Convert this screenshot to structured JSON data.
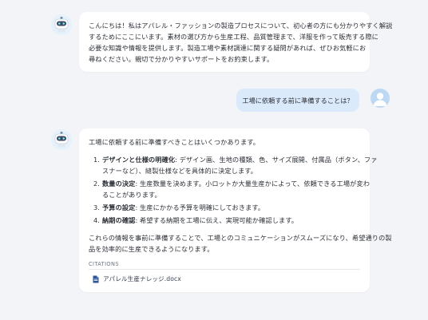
{
  "messages": {
    "bot1": {
      "lines": [
        "こんにちは！私はアパレル・ファッションの製造プロセスについて、初心者の方にも分かりやすく解説",
        "するためにここにいます。素材の選び方から生産工程、品質管理まで、洋服を作って販売する際に",
        "必要な知識や情報を提供します。製造工場や素材調達に関する疑問があれば、ぜひお気軽にお",
        "尋ねください。親切で分かりやすいサポートをお約束します。"
      ]
    },
    "user1": {
      "text": "工場に依頼する前に準備することは？"
    },
    "bot2": {
      "intro": "工場に依頼する前に準備すべきことはいくつかあります。",
      "items": [
        {
          "num": "1.",
          "title": "デザインと仕様の明確化",
          "lines": [
            ": デザイン画、生地の種類、色、サイズ展開、付属品（ボタン、ファ",
            "スナーなど）、縫製仕様などを具体的に決定します。"
          ]
        },
        {
          "num": "2.",
          "title": "数量の決定",
          "lines": [
            ": 生産数量を決めます。小ロットか大量生産かによって、依頼できる工場が変わ",
            "ることがあります。"
          ]
        },
        {
          "num": "3.",
          "title": "予算の設定",
          "lines": [
            ": 生産にかかる予算を明確にしておきます。"
          ]
        },
        {
          "num": "4.",
          "title": "納期の確認",
          "lines": [
            ": 希望する納期を工場に伝え、実現可能か確認します。"
          ]
        }
      ],
      "closing": [
        "これらの情報を事前に準備することで、工場とのコミュニケーションがスムーズになり、希望通りの製",
        "品を効率的に生産できるようになります。"
      ],
      "citations_label": "CITATIONS",
      "citation_file": "アパレル生産ナレッジ.docx"
    }
  },
  "colors": {
    "background": "#f2f4f7",
    "bot_bubble": "#ffffff",
    "user_bubble": "#dbeafb",
    "file_icon": "#2f5597"
  },
  "icons": {
    "bot_avatar": "robot-icon",
    "user_avatar": "user-icon",
    "file": "word-document-icon"
  }
}
